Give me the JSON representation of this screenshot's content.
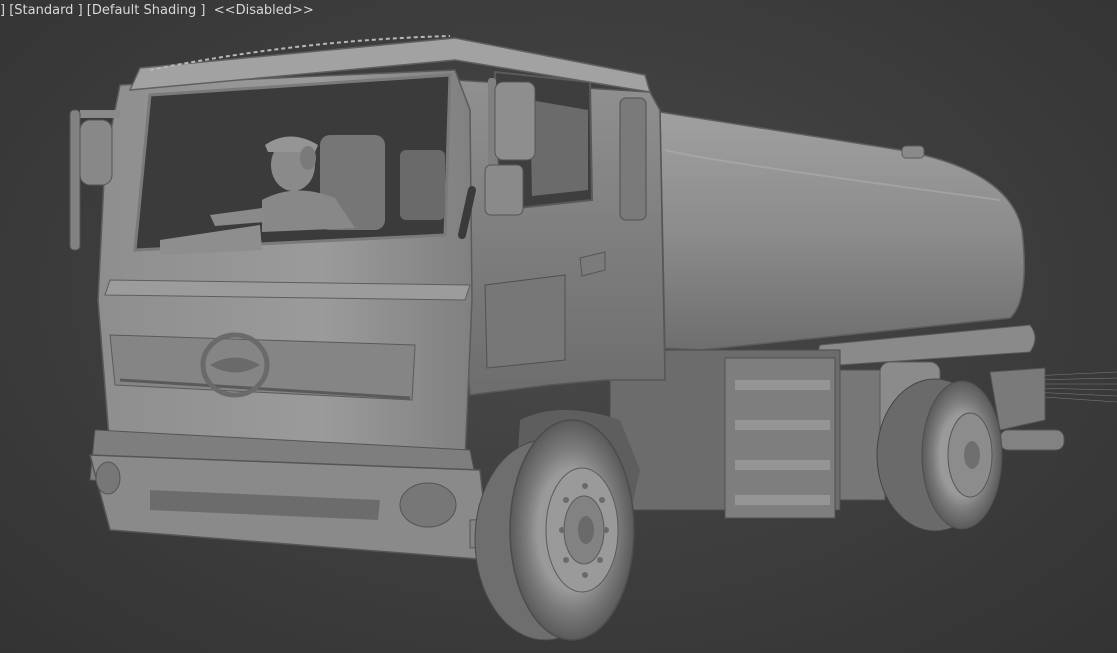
{
  "viewport": {
    "label_prefix": "] ",
    "view_mode": "[Standard ]",
    "shading_mode": "[Default Shading ]",
    "status": "<<Disabled>>"
  },
  "scene": {
    "object": "tanker-truck-model",
    "figure": "driver",
    "colors": {
      "background": "#3d3d3d",
      "model_base": "#8a8a8a",
      "model_light": "#a9a9a9",
      "model_shadow": "#5a5a5a",
      "dark": "#3a3a3a"
    }
  }
}
